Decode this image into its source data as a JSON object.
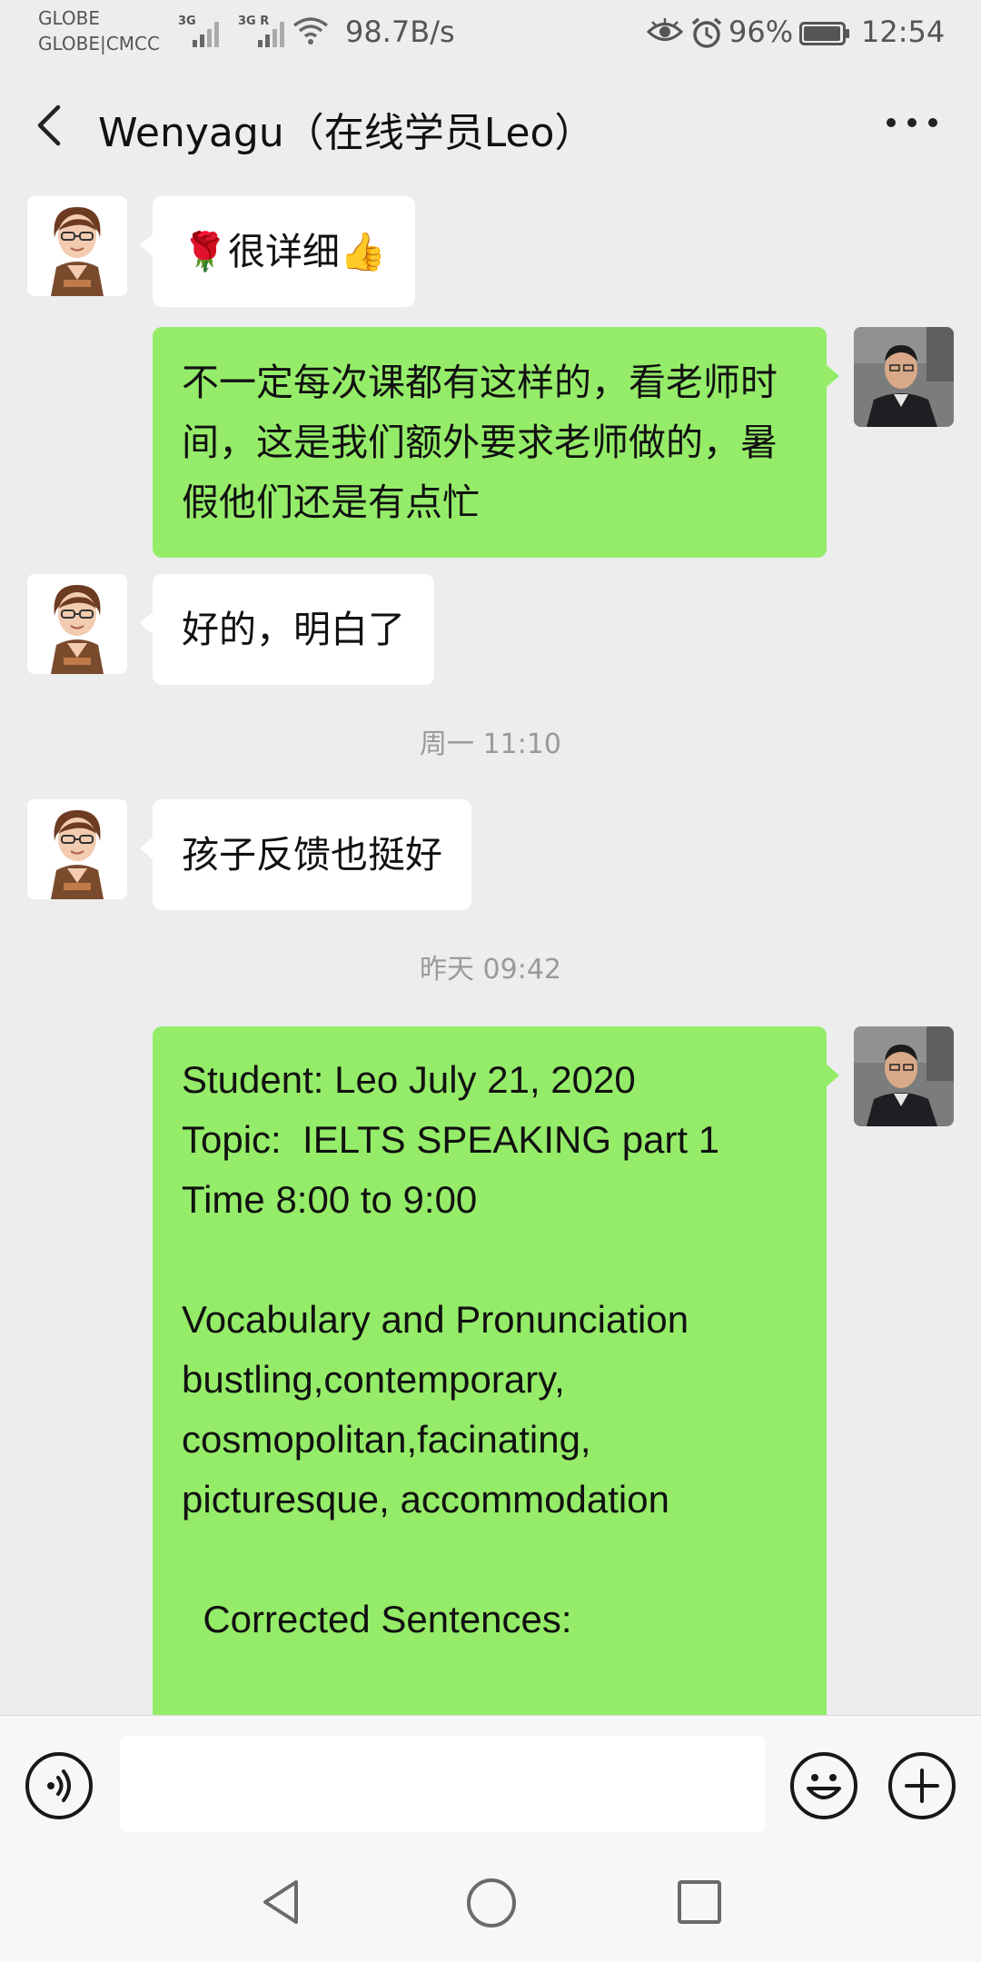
{
  "status_bar": {
    "carrier_1": "GLOBE",
    "carrier_2": "GLOBE|CMCC",
    "signal_1_label": "3G",
    "signal_2_label": "3G R",
    "network_speed": "98.7B/s",
    "battery_percent": "96%",
    "time": "12:54",
    "icons": [
      "signal-icon",
      "wifi-icon",
      "eye-icon",
      "alarm-icon",
      "battery-icon"
    ]
  },
  "header": {
    "title": "Wenyagu（在线学员Leo）",
    "back_icon": "chevron-left-icon",
    "more_icon": "more-icon"
  },
  "messages": [
    {
      "side": "in",
      "text": "🌹很详细👍"
    },
    {
      "side": "out",
      "text": "不一定每次课都有这样的，看老师时间，这是我们额外要求老师做的，暑假他们还是有点忙"
    },
    {
      "side": "in",
      "text": "好的，明白了"
    },
    {
      "type": "timestamp",
      "text": "周一 11:10"
    },
    {
      "side": "in",
      "text": "孩子反馈也挺好"
    },
    {
      "type": "timestamp",
      "text": "昨天 09:42"
    },
    {
      "side": "out",
      "text": "Student: Leo July 21, 2020\nTopic:  IELTS SPEAKING part 1\nTime 8:00 to 9:00\n\nVocabulary and Pronunciation\nbustling,contemporary,\ncosmopolitan,facinating,\npicturesque, accommodation\n\n  Corrected Sentences:"
    }
  ],
  "input_bar": {
    "placeholder": "",
    "voice_icon": "voice-icon",
    "emoji_icon": "emoji-icon",
    "plus_icon": "plus-icon"
  },
  "nav_bar": {
    "icons": [
      "nav-back-icon",
      "nav-home-icon",
      "nav-recent-icon"
    ]
  },
  "colors": {
    "background": "#ededed",
    "outgoing_bubble": "#95ec69",
    "incoming_bubble": "#ffffff",
    "timestamp_text": "#9a9a9a"
  }
}
